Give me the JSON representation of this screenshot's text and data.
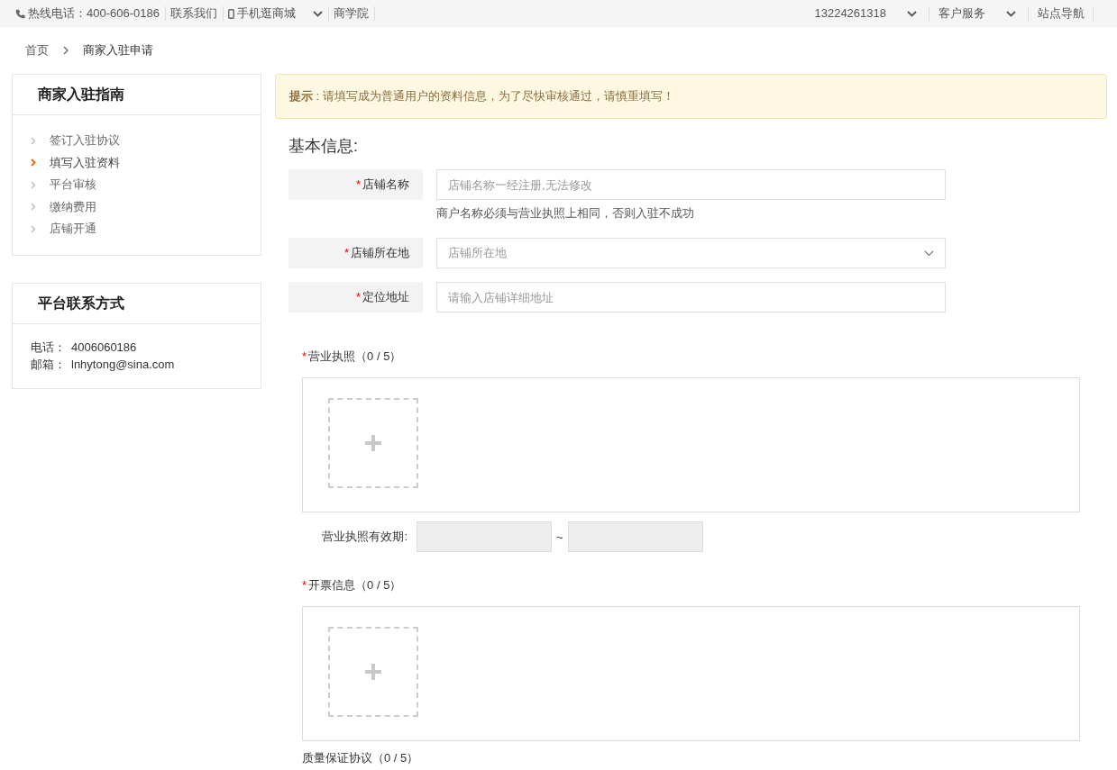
{
  "top_bar": {
    "left": [
      {
        "text": "热线电话：400-606-0186",
        "kind": "phone",
        "dropdown": false
      },
      {
        "text": "联系我们",
        "kind": "plain",
        "dropdown": false
      },
      {
        "text": "手机逛商城",
        "kind": "mobile",
        "dropdown": true
      },
      {
        "text": "商学院",
        "kind": "plain",
        "dropdown": false
      }
    ],
    "right": [
      {
        "text": "13224261318",
        "dropdown": true
      },
      {
        "text": "客户服务",
        "dropdown": true
      },
      {
        "text": "站点导航",
        "dropdown": false
      }
    ]
  },
  "breadcrumb": [
    "首页",
    "商家入驻申请"
  ],
  "sidebar": {
    "guide": {
      "title": "商家入驻指南",
      "items": [
        {
          "label": "签订入驻协议",
          "selected": false
        },
        {
          "label": "填写入驻资料",
          "selected": true
        },
        {
          "label": "平台审核",
          "selected": false
        },
        {
          "label": "缴纳费用",
          "selected": false
        },
        {
          "label": "店铺开通",
          "selected": false
        }
      ]
    },
    "contact": {
      "title": "平台联系方式",
      "rows": [
        {
          "label": "电话：",
          "value": "4006060186"
        },
        {
          "label": "邮箱：",
          "value": "lnhytong@sina.com"
        }
      ]
    }
  },
  "notice": {
    "title": "提示",
    "text": ": 请填写成为普通用户的资料信息，为了尽快审核通过，请慎重填写！"
  },
  "section_title": "基本信息:",
  "fields": [
    {
      "label": "店铺名称",
      "mark": "*",
      "kind": "text",
      "placeholder": "店铺名称一经注册,无法修改",
      "hint": "商户名称必须与营业执照上相同，否则入驻不成功"
    },
    {
      "label": "店铺所在地",
      "mark": "*",
      "kind": "select",
      "placeholder": "店铺所在地"
    },
    {
      "label": "定位地址",
      "mark": "*",
      "kind": "text",
      "placeholder": "请输入店铺详细地址"
    }
  ],
  "sections": [
    {
      "kind": "upload",
      "label": "营业执照（0 / 5）",
      "mark": "*"
    },
    {
      "kind": "date_range",
      "label": "营业执照有效期:",
      "separator": "~"
    },
    {
      "kind": "upload",
      "label": "开票信息（0 / 5）",
      "mark": "*"
    },
    {
      "kind": "heading",
      "label": "质量保证协议（0 / 5）"
    }
  ]
}
